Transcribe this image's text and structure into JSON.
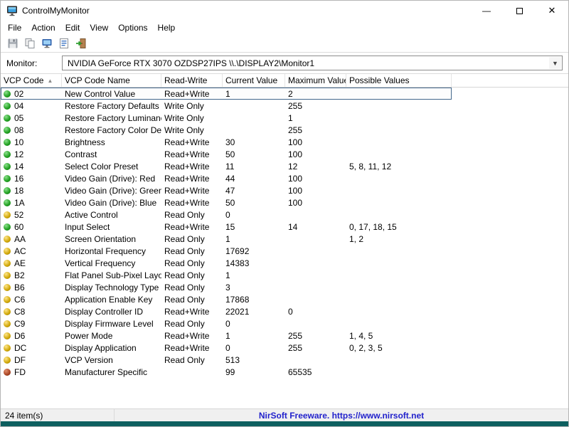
{
  "window": {
    "title": "ControlMyMonitor",
    "minimize_glyph": "—",
    "close_glyph": "✕"
  },
  "menu": {
    "items": [
      "File",
      "Action",
      "Edit",
      "View",
      "Options",
      "Help"
    ]
  },
  "toolbar": {
    "icons": [
      "save-icon",
      "copy-icon",
      "properties-icon",
      "report-icon",
      "exit-icon"
    ]
  },
  "monitor": {
    "label": "Monitor:",
    "value": "NVIDIA GeForce RTX 3070  OZDSP27IPS    \\\\.\\DISPLAY2\\Monitor1",
    "arrow_glyph": "▼"
  },
  "table": {
    "columns": [
      "VCP Code",
      "VCP Code Name",
      "Read-Write",
      "Current Value",
      "Maximum Value",
      "Possible Values"
    ],
    "sort_column": "VCP Code",
    "sort_glyph": "▲",
    "rows": [
      {
        "dot": "green",
        "code": "02",
        "name": "New Control Value",
        "rw": "Read+Write",
        "current": "1",
        "max": "2",
        "possible": "",
        "selected": true
      },
      {
        "dot": "green",
        "code": "04",
        "name": "Restore Factory Defaults",
        "rw": "Write Only",
        "current": "",
        "max": "255",
        "possible": "",
        "selected": false
      },
      {
        "dot": "green",
        "code": "05",
        "name": "Restore Factory Luminance/ ...",
        "rw": "Write Only",
        "current": "",
        "max": "1",
        "possible": "",
        "selected": false
      },
      {
        "dot": "green",
        "code": "08",
        "name": "Restore Factory Color Defaul...",
        "rw": "Write Only",
        "current": "",
        "max": "255",
        "possible": "",
        "selected": false
      },
      {
        "dot": "green",
        "code": "10",
        "name": "Brightness",
        "rw": "Read+Write",
        "current": "30",
        "max": "100",
        "possible": "",
        "selected": false
      },
      {
        "dot": "green",
        "code": "12",
        "name": "Contrast",
        "rw": "Read+Write",
        "current": "50",
        "max": "100",
        "possible": "",
        "selected": false
      },
      {
        "dot": "green",
        "code": "14",
        "name": "Select Color Preset",
        "rw": "Read+Write",
        "current": "11",
        "max": "12",
        "possible": "5, 8, 11, 12",
        "selected": false
      },
      {
        "dot": "green",
        "code": "16",
        "name": "Video Gain (Drive): Red",
        "rw": "Read+Write",
        "current": "44",
        "max": "100",
        "possible": "",
        "selected": false
      },
      {
        "dot": "green",
        "code": "18",
        "name": "Video Gain (Drive): Green",
        "rw": "Read+Write",
        "current": "47",
        "max": "100",
        "possible": "",
        "selected": false
      },
      {
        "dot": "green",
        "code": "1A",
        "name": "Video Gain (Drive): Blue",
        "rw": "Read+Write",
        "current": "50",
        "max": "100",
        "possible": "",
        "selected": false
      },
      {
        "dot": "yellow",
        "code": "52",
        "name": "Active Control",
        "rw": "Read Only",
        "current": "0",
        "max": "",
        "possible": "",
        "selected": false
      },
      {
        "dot": "green",
        "code": "60",
        "name": "Input Select",
        "rw": "Read+Write",
        "current": "15",
        "max": "14",
        "possible": "0, 17, 18, 15",
        "selected": false
      },
      {
        "dot": "yellow",
        "code": "AA",
        "name": "Screen Orientation",
        "rw": "Read Only",
        "current": "1",
        "max": "",
        "possible": "1, 2",
        "selected": false
      },
      {
        "dot": "yellow",
        "code": "AC",
        "name": "Horizontal Frequency",
        "rw": "Read Only",
        "current": "17692",
        "max": "",
        "possible": "",
        "selected": false
      },
      {
        "dot": "yellow",
        "code": "AE",
        "name": "Vertical Frequency",
        "rw": "Read Only",
        "current": "14383",
        "max": "",
        "possible": "",
        "selected": false
      },
      {
        "dot": "yellow",
        "code": "B2",
        "name": "Flat Panel Sub-Pixel Layout",
        "rw": "Read Only",
        "current": "1",
        "max": "",
        "possible": "",
        "selected": false
      },
      {
        "dot": "yellow",
        "code": "B6",
        "name": "Display Technology Type",
        "rw": "Read Only",
        "current": "3",
        "max": "",
        "possible": "",
        "selected": false
      },
      {
        "dot": "yellow",
        "code": "C6",
        "name": "Application Enable Key",
        "rw": "Read Only",
        "current": "17868",
        "max": "",
        "possible": "",
        "selected": false
      },
      {
        "dot": "yellow",
        "code": "C8",
        "name": "Display Controller ID",
        "rw": "Read+Write",
        "current": "22021",
        "max": "0",
        "possible": "",
        "selected": false
      },
      {
        "dot": "yellow",
        "code": "C9",
        "name": "Display Firmware Level",
        "rw": "Read Only",
        "current": "0",
        "max": "",
        "possible": "",
        "selected": false
      },
      {
        "dot": "yellow",
        "code": "D6",
        "name": "Power Mode",
        "rw": "Read+Write",
        "current": "1",
        "max": "255",
        "possible": "1, 4, 5",
        "selected": false
      },
      {
        "dot": "yellow",
        "code": "DC",
        "name": "Display Application",
        "rw": "Read+Write",
        "current": "0",
        "max": "255",
        "possible": "0, 2, 3, 5",
        "selected": false
      },
      {
        "dot": "yellow",
        "code": "DF",
        "name": "VCP Version",
        "rw": "Read Only",
        "current": "513",
        "max": "",
        "possible": "",
        "selected": false
      },
      {
        "dot": "red",
        "code": "FD",
        "name": "Manufacturer Specific",
        "rw": "",
        "current": "99",
        "max": "65535",
        "possible": "",
        "selected": false
      }
    ]
  },
  "statusbar": {
    "items_count": "24 item(s)",
    "link": "NirSoft Freeware. https://www.nirsoft.net"
  },
  "colors": {
    "accent_teal": "#0d5f5f",
    "link_blue": "#2222cc",
    "dot_green": "#1f9e1f",
    "dot_yellow": "#cfa606",
    "dot_red": "#a84322"
  }
}
